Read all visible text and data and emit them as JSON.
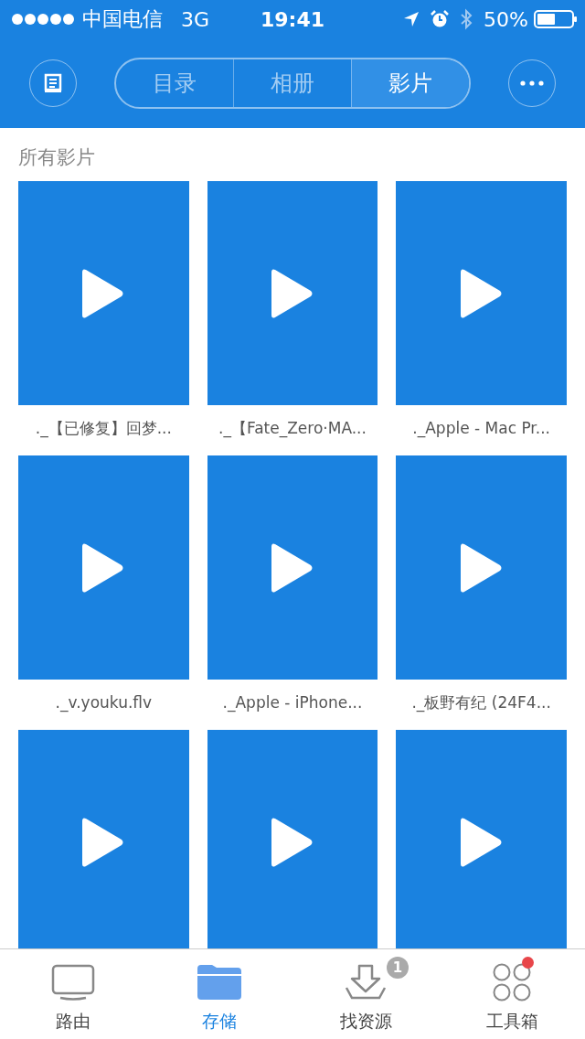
{
  "status_bar": {
    "carrier": "中国电信",
    "network": "3G",
    "time": "19:41",
    "battery": "50%"
  },
  "segments": [
    {
      "label": "目录",
      "selected": false
    },
    {
      "label": "相册",
      "selected": false
    },
    {
      "label": "影片",
      "selected": true
    }
  ],
  "section_title": "所有影片",
  "videos": [
    {
      "kind": "video",
      "name": "._【已修复】回梦..."
    },
    {
      "kind": "video",
      "name": "._【Fate_Zero·MA..."
    },
    {
      "kind": "video",
      "name": "._Apple - Mac Pr..."
    },
    {
      "kind": "video",
      "name": "._v.youku.flv"
    },
    {
      "kind": "video",
      "name": "._Apple - iPhone..."
    },
    {
      "kind": "video",
      "name": "._板野有纪 (24F4..."
    },
    {
      "kind": "video"
    },
    {
      "kind": "video"
    },
    {
      "kind": "video"
    }
  ],
  "tab_bar": [
    {
      "label": "路由",
      "kind": "tv",
      "selected": false
    },
    {
      "label": "存储",
      "kind": "folder",
      "selected": true
    },
    {
      "label": "找资源",
      "kind": "download",
      "selected": false,
      "badge": "1"
    },
    {
      "label": "工具箱",
      "kind": "apps",
      "selected": false,
      "dot": true
    }
  ]
}
